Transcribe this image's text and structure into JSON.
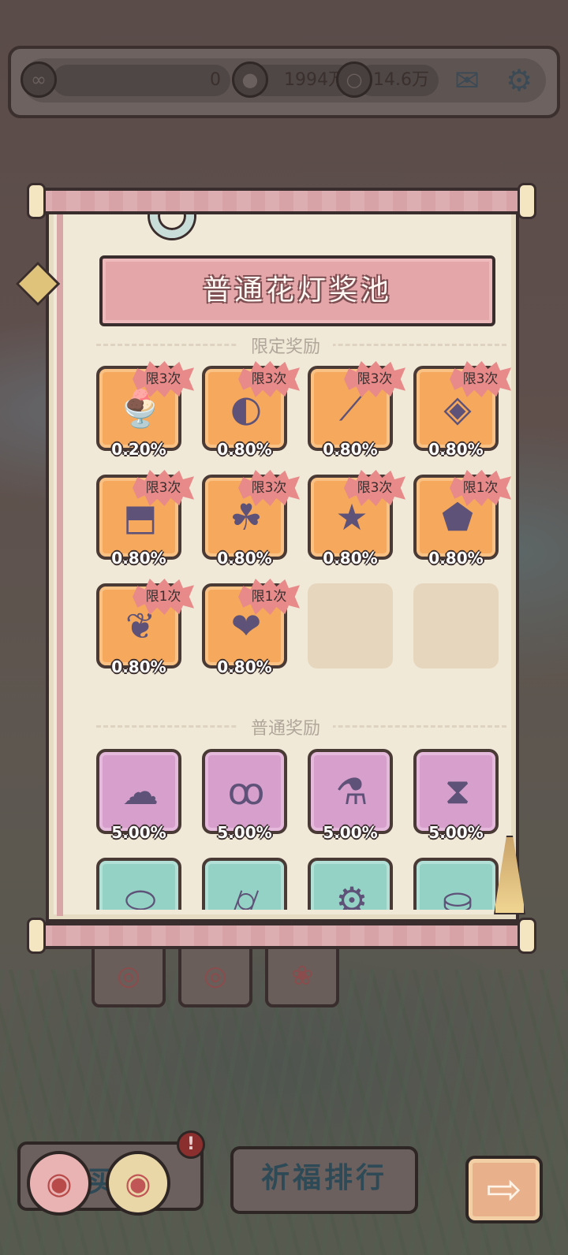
{
  "top_bar": {
    "resource_1_value": "0",
    "resource_2_value": "1994万",
    "resource_3_value": "14.6万",
    "mail_icon": "mail-icon",
    "settings_icon": "gear-icon"
  },
  "pool": {
    "title": "普通花灯奖池",
    "limited_section_label": "限定奖励",
    "normal_section_label": "普通奖励",
    "limited_items": [
      {
        "icon": "ice-cream-bowl-icon",
        "rate": "0.20%",
        "limit": "限3次"
      },
      {
        "icon": "armored-fish-icon",
        "rate": "0.80%",
        "limit": "限3次"
      },
      {
        "icon": "firework-stick-icon",
        "rate": "0.80%",
        "limit": "限3次"
      },
      {
        "icon": "gem-box-icon",
        "rate": "0.80%",
        "limit": "限3次"
      },
      {
        "icon": "striped-jar-icon",
        "rate": "0.80%",
        "limit": "限3次"
      },
      {
        "icon": "clover-coin-icon",
        "rate": "0.80%",
        "limit": "限3次"
      },
      {
        "icon": "purple-star-icon",
        "rate": "0.80%",
        "limit": "限3次"
      },
      {
        "icon": "stone-fossil-icon",
        "rate": "0.80%",
        "limit": "限1次"
      },
      {
        "icon": "feather-wings-icon",
        "rate": "0.80%",
        "limit": "限1次"
      },
      {
        "icon": "winged-heart-icon",
        "rate": "0.80%",
        "limit": "限1次"
      }
    ],
    "normal_items": [
      {
        "icon": "ghost-icon",
        "rate": "5.00%"
      },
      {
        "icon": "snail-creature-icon",
        "rate": "5.00%"
      },
      {
        "icon": "molecule-flask-icon",
        "rate": "5.00%"
      },
      {
        "icon": "hourglass-icon",
        "rate": "5.00%"
      },
      {
        "icon": "capsule-icon",
        "rate": ""
      },
      {
        "icon": "telescope-icon",
        "rate": ""
      },
      {
        "icon": "machine-icon",
        "rate": ""
      },
      {
        "icon": "cake-stand-icon",
        "rate": ""
      }
    ]
  },
  "bottom": {
    "bag_label": "买",
    "alert_badge": "!",
    "pray_rank_label": "祈福排行",
    "next_arrow": "⇨"
  },
  "colors": {
    "limited_slot": "#f6a95c",
    "normal_slot_pink": "#d79fcc",
    "normal_slot_teal": "#93d2c4",
    "limit_badge": "#e88a8a",
    "scroll_rod": "#d8a3a6"
  }
}
